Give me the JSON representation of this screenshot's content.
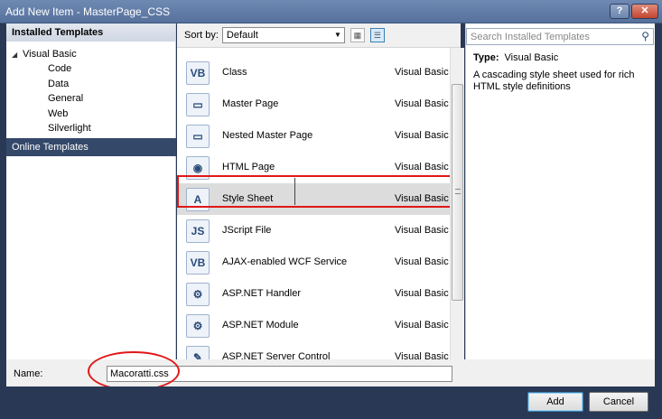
{
  "window": {
    "title": "Add New Item - MasterPage_CSS",
    "help": "?",
    "close": "✕"
  },
  "left": {
    "header": "Installed Templates",
    "tree_root": "Visual Basic",
    "tree_items": [
      "Code",
      "Data",
      "General",
      "Web",
      "Silverlight"
    ],
    "online": "Online Templates"
  },
  "sortbar": {
    "label": "Sort by:",
    "value": "Default"
  },
  "templates": [
    {
      "name": "Class",
      "lang": "Visual Basic",
      "icon": "vb-class-icon",
      "glyph": "VB"
    },
    {
      "name": "Master Page",
      "lang": "Visual Basic",
      "icon": "master-page-icon",
      "glyph": "▭"
    },
    {
      "name": "Nested Master Page",
      "lang": "Visual Basic",
      "icon": "nested-master-page-icon",
      "glyph": "▭"
    },
    {
      "name": "HTML Page",
      "lang": "Visual Basic",
      "icon": "html-page-icon",
      "glyph": "◉"
    },
    {
      "name": "Style Sheet",
      "lang": "Visual Basic",
      "icon": "style-sheet-icon",
      "glyph": "A"
    },
    {
      "name": "JScript File",
      "lang": "Visual Basic",
      "icon": "jscript-file-icon",
      "glyph": "JS"
    },
    {
      "name": "AJAX-enabled WCF Service",
      "lang": "Visual Basic",
      "icon": "wcf-service-icon",
      "glyph": "VB"
    },
    {
      "name": "ASP.NET Handler",
      "lang": "Visual Basic",
      "icon": "aspnet-handler-icon",
      "glyph": "⚙"
    },
    {
      "name": "ASP.NET Module",
      "lang": "Visual Basic",
      "icon": "aspnet-module-icon",
      "glyph": "⚙"
    },
    {
      "name": "ASP.NET Server Control",
      "lang": "Visual Basic",
      "icon": "server-control-icon",
      "glyph": "✎"
    }
  ],
  "selected_template": "Style Sheet",
  "search": {
    "placeholder": "Search Installed Templates"
  },
  "details": {
    "type_label": "Type:",
    "type_value": "Visual Basic",
    "description": "A cascading style sheet used for rich HTML style definitions"
  },
  "namebar": {
    "label": "Name:",
    "value": "Macoratti.css"
  },
  "buttons": {
    "add": "Add",
    "cancel": "Cancel"
  },
  "colors": {
    "frame": "#293955",
    "highlight": "#e01818",
    "selected_row": "#dcdcdc"
  }
}
